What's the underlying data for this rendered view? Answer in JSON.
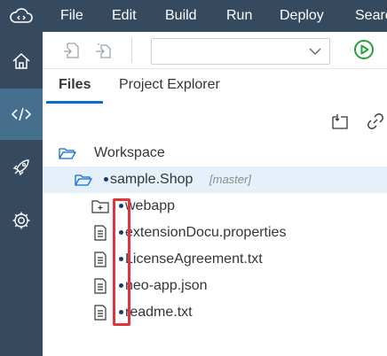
{
  "menubar": {
    "items": [
      "File",
      "Edit",
      "Build",
      "Run",
      "Deploy",
      "Search"
    ],
    "logo_icon": "cloud-code-icon"
  },
  "sidebar": {
    "items": [
      {
        "icon": "home-icon"
      },
      {
        "icon": "code-icon",
        "active": true
      },
      {
        "icon": "rocket-icon"
      },
      {
        "icon": "gear-icon"
      }
    ]
  },
  "toolbar": {
    "run_config_value": "",
    "run_icon_color": "#2b9f3a"
  },
  "tabs": [
    "Files",
    "Project Explorer"
  ],
  "tree": {
    "workspace": "Workspace",
    "project": "sample.Shop",
    "branch": "[master]",
    "items": [
      "webapp",
      "extensionDocu.properties",
      "LicenseAgreement.txt",
      "neo-app.json",
      "readme.txt"
    ]
  },
  "colors": {
    "shell": "#354a5f",
    "active_sidebar": "#466f8e",
    "accent": "#0a6ed1",
    "highlight": "#e0353d"
  }
}
